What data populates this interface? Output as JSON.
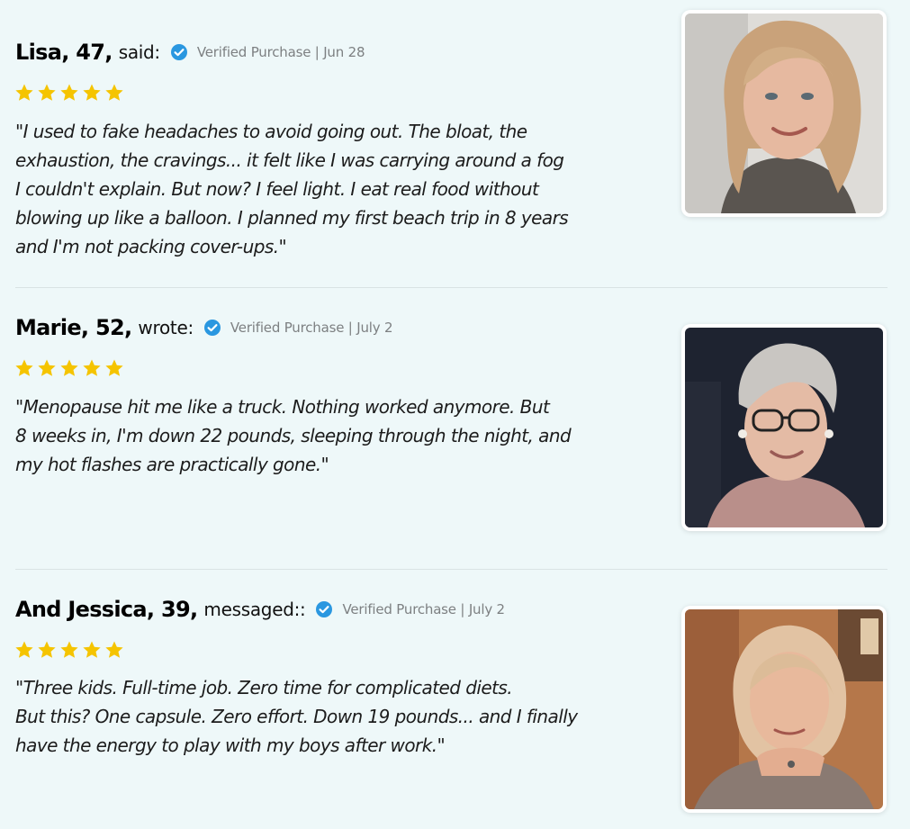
{
  "colors": {
    "background": "#eef8f9",
    "star": "#f5c400",
    "verified_badge": "#2a97e0",
    "divider": "#d9e3e4"
  },
  "reviews": [
    {
      "name": "Lisa, 47,",
      "verb": "said:",
      "verified": "Verified Purchase | Jun 28",
      "rating": 5,
      "quote": "\"I used to fake headaches to avoid going out. The bloat, the\nexhaustion, the cravings... it felt like I was carrying around a fog\nI couldn't explain. But now? I feel light. I eat real food without\nblowing up like a balloon. I planned my first beach trip in 8 years\nand I'm not packing cover-ups.\"",
      "photo_alt": "Smiling woman with blonde hair"
    },
    {
      "name": "Marie, 52,",
      "verb": "wrote:",
      "verified": "Verified Purchase | July 2",
      "rating": 5,
      "quote": "\"Menopause hit me like a truck. Nothing worked anymore. But\n8 weeks in, I'm down 22 pounds, sleeping through the night, and\nmy hot flashes are practically gone.\"",
      "photo_alt": "Smiling woman with short gray hair and glasses"
    },
    {
      "name": "And Jessica, 39,",
      "verb": "messaged::",
      "verified": "Verified Purchase | July 2",
      "rating": 5,
      "quote": "\"Three kids. Full-time job. Zero time for complicated diets.\nBut this? One capsule. Zero effort. Down 19 pounds... and I finally\nhave the energy to play with my boys after work.\"",
      "photo_alt": "Woman with short blonde hair resting chin on hands"
    }
  ]
}
